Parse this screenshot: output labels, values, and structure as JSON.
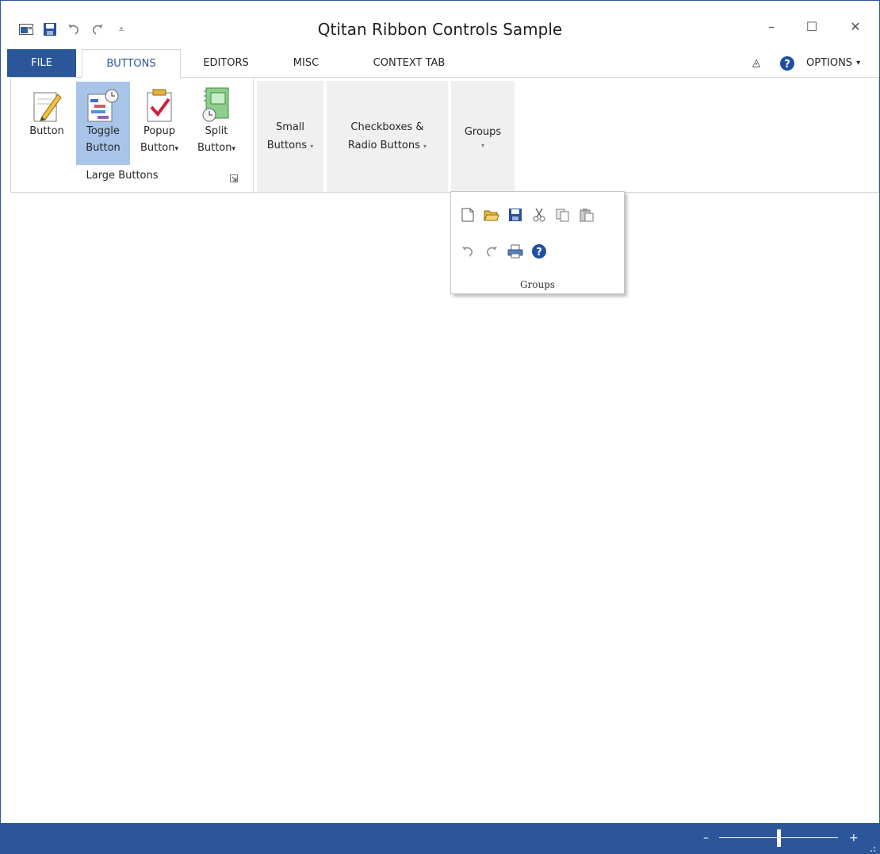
{
  "window": {
    "title": "Qtitan Ribbon Controls Sample",
    "accent": "#2b579a"
  },
  "qat": {
    "icons": [
      "app-icon",
      "save-icon",
      "undo-icon",
      "redo-icon",
      "customize-qat-icon"
    ],
    "customize_glyph": "⩡"
  },
  "window_controls": {
    "minimize": "–",
    "maximize": "☐",
    "close": "✕"
  },
  "tabs": [
    {
      "label": "FILE"
    },
    {
      "label": "BUTTONS"
    },
    {
      "label": "EDITORS"
    },
    {
      "label": "MISC"
    },
    {
      "label": "CONTEXT TAB"
    }
  ],
  "tab_right": {
    "collapse_glyph": "◬",
    "options_label": "OPTIONS",
    "options_arrow": "▾"
  },
  "large_buttons": {
    "group_label": "Large Buttons",
    "items": [
      {
        "line1": "Button",
        "line2": ""
      },
      {
        "line1": "Toggle",
        "line2": "Button"
      },
      {
        "line1": "Popup",
        "line2": "Button"
      },
      {
        "line1": "Split",
        "line2": "Button"
      }
    ],
    "arrow": "▾"
  },
  "collapsed_groups": [
    {
      "line1": "Small",
      "line2": "Buttons",
      "arrow": "▾"
    },
    {
      "line1": "Checkboxes &",
      "line2": "Radio Buttons",
      "arrow": "▾"
    },
    {
      "line1": "Groups",
      "line2": "",
      "arrow": "▾"
    }
  ],
  "groups_popup": {
    "label": "Groups",
    "row1_icons": [
      "new-icon",
      "open-icon",
      "save-icon",
      "cut-icon",
      "copy-icon",
      "paste-icon"
    ],
    "row2_icons": [
      "undo-icon",
      "redo-icon",
      "print-icon",
      "help-icon"
    ]
  },
  "statusbar": {
    "zoom_minus": "–",
    "zoom_plus": "+",
    "zoom_level": 0.5
  }
}
